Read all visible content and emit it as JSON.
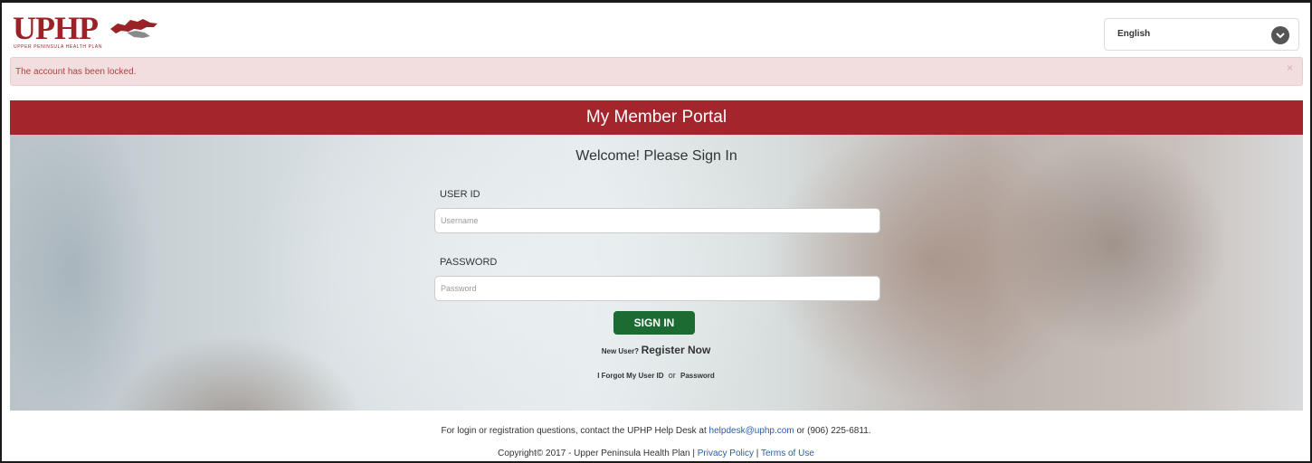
{
  "header": {
    "logo_text": "UPHP",
    "logo_subtitle": "UPPER PENINSULA HEALTH PLAN",
    "language": "English"
  },
  "alert": {
    "message": "The account has been locked.",
    "close": "×"
  },
  "portal": {
    "title": "My Member Portal",
    "welcome": "Welcome! Please Sign In"
  },
  "form": {
    "user_id_label": "USER ID",
    "user_id_placeholder": "Username",
    "password_label": "PASSWORD",
    "password_placeholder": "Password",
    "sign_in_label": "SIGN IN"
  },
  "links": {
    "new_user_prefix": "New User?",
    "register": "Register Now",
    "forgot_prefix": "I Forgot My User ID",
    "or": "or",
    "password": "Password"
  },
  "footer": {
    "contact_prefix": "For login or registration questions, contact the UPHP Help Desk at",
    "email": "helpdesk@uphp.com",
    "contact_suffix": "or (906) 225-6811.",
    "copyright": "Copyright© 2017 - Upper Peninsula Health Plan |",
    "privacy": "Privacy Policy",
    "separator": "|",
    "terms": "Terms of Use"
  },
  "colors": {
    "brand_red": "#a4262c",
    "button_green": "#1c6b33",
    "alert_bg": "#f2dede",
    "link_blue": "#2a5ca8"
  }
}
